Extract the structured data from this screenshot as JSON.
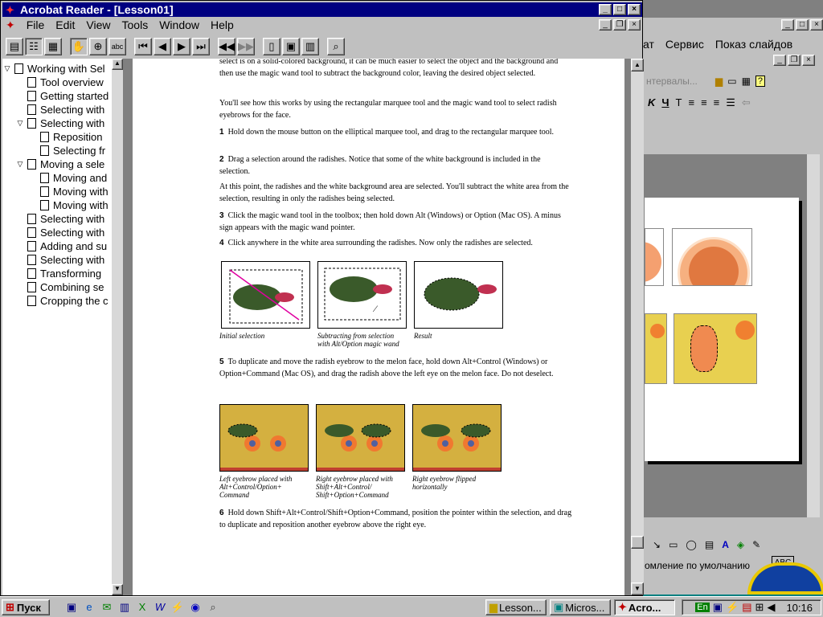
{
  "acrobat": {
    "title": "Acrobat Reader - [Lesson01]",
    "menu": [
      "File",
      "Edit",
      "View",
      "Tools",
      "Window",
      "Help"
    ],
    "toolbar_icons": [
      "page-only-icon",
      "bookmarks-pane-icon",
      "thumbnails-icon",
      "hand-tool-icon",
      "zoom-tool-icon",
      "text-select-icon",
      "first-page-icon",
      "prev-page-icon",
      "next-page-icon",
      "last-page-icon",
      "go-back-icon",
      "go-forward-icon",
      "actual-size-icon",
      "fit-page-icon",
      "fit-width-icon",
      "find-icon"
    ]
  },
  "bookmarks": [
    {
      "label": "Working with Sel",
      "level": 0,
      "expand": "open"
    },
    {
      "label": "Tool overview",
      "level": 1,
      "expand": ""
    },
    {
      "label": "Getting started",
      "level": 1,
      "expand": ""
    },
    {
      "label": "Selecting with",
      "level": 1,
      "expand": ""
    },
    {
      "label": "Selecting with",
      "level": 1,
      "expand": "open"
    },
    {
      "label": "Reposition",
      "level": 2,
      "expand": ""
    },
    {
      "label": "Selecting fr",
      "level": 2,
      "expand": ""
    },
    {
      "label": "Moving a sele",
      "level": 1,
      "expand": "open"
    },
    {
      "label": "Moving and",
      "level": 2,
      "expand": ""
    },
    {
      "label": "Moving with",
      "level": 2,
      "expand": ""
    },
    {
      "label": "Moving with",
      "level": 2,
      "expand": ""
    },
    {
      "label": "Selecting with",
      "level": 1,
      "expand": ""
    },
    {
      "label": "Selecting with",
      "level": 1,
      "expand": ""
    },
    {
      "label": "Adding and su",
      "level": 1,
      "expand": ""
    },
    {
      "label": "Selecting with",
      "level": 1,
      "expand": ""
    },
    {
      "label": "Transforming",
      "level": 1,
      "expand": ""
    },
    {
      "label": "Combining se",
      "level": 1,
      "expand": ""
    },
    {
      "label": "Cropping the c",
      "level": 1,
      "expand": ""
    }
  ],
  "doc": {
    "p1": "select is on a solid-colored background, it can be much easier to select the object and the background and then use the magic wand tool to subtract the background color, leaving the desired object selected.",
    "p2": "You'll see how this works by using the rectangular marquee tool and the magic wand tool to select radish eyebrows for the face.",
    "s1n": "1",
    "s1": "Hold down the mouse button on the elliptical marquee tool, and drag to the rectangular marquee tool.",
    "s2n": "2",
    "s2": "Drag a selection around the radishes. Notice that some of the white background is included in the selection.",
    "p3": "At this point, the radishes and the white background area are selected. You'll subtract the white area from the selection, resulting in only the radishes being selected.",
    "s3n": "3",
    "s3": "Click the magic wand tool in the toolbox; then hold down Alt (Windows) or Option (Mac OS). A minus sign appears with the magic wand pointer.",
    "s4n": "4",
    "s4": "Click anywhere in the white area surrounding the radishes. Now only the radishes are selected.",
    "captions1": [
      "Initial selection",
      "Subtracting from selection with Alt/Option magic wand",
      "Result"
    ],
    "s5n": "5",
    "s5": "To duplicate and move the radish eyebrow to the melon face, hold down Alt+Control (Windows) or Option+Command (Mac OS), and drag the radish above the left eye on the melon face. Do not deselect.",
    "captions2": [
      "Left eyebrow placed with Alt+Control/Option+ Command",
      "Right eyebrow placed with Shift+Alt+Control/ Shift+Option+Command",
      "Right eyebrow flipped horizontally"
    ],
    "s6n": "6",
    "s6": "Hold down Shift+Alt+Control/Shift+Option+Command, position the pointer within the selection, and drag to duplicate and reposition another eyebrow above the right eye."
  },
  "powerpoint": {
    "menu": [
      "ат",
      "Сервис",
      "Показ слайдов"
    ],
    "toolbar_text": "нтервалы...",
    "status": "омление по умолчанию"
  },
  "taskbar": {
    "start": "Пуск",
    "tasks": [
      "Lesson...",
      "Micros...",
      "Acro..."
    ],
    "lang": "En",
    "clock": "10:16"
  },
  "colors": {
    "title_active": "#000080",
    "face": "#c0c0c0",
    "desktop": "#008080"
  }
}
